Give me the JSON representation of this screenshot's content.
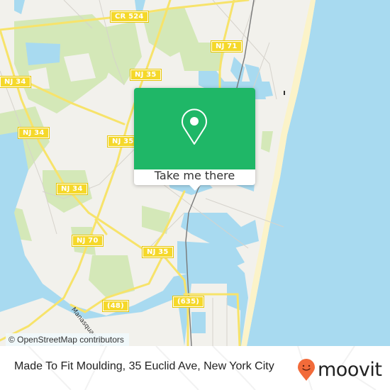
{
  "map": {
    "road_labels": [
      {
        "id": "cr524",
        "text": "CR 524"
      },
      {
        "id": "nj71",
        "text": "NJ 71"
      },
      {
        "id": "nj35-a",
        "text": "NJ 35"
      },
      {
        "id": "nj35-b",
        "text": "NJ 35"
      },
      {
        "id": "nj35-c",
        "text": "NJ 35"
      },
      {
        "id": "nj34-a",
        "text": "NJ 34"
      },
      {
        "id": "nj34-b",
        "text": "NJ 34"
      },
      {
        "id": "nj34-c",
        "text": "NJ 34"
      },
      {
        "id": "nj70",
        "text": "NJ 70"
      },
      {
        "id": "r48",
        "text": "(48)"
      },
      {
        "id": "r635",
        "text": "(635)"
      }
    ],
    "water_labels": [
      {
        "id": "manasquan",
        "text": "Manasquan River"
      }
    ],
    "attribution": "© OpenStreetMap contributors",
    "colors": {
      "land": "#f2f1ec",
      "water": "#a8daf0",
      "park": "#cfe5b0",
      "road": "#f7e36a",
      "beach": "#fbf3c9"
    }
  },
  "popup": {
    "icon": "location-pin-icon",
    "button_label": "Take me there",
    "color": "#1fb767"
  },
  "footer": {
    "title": "Made To Fit Moulding, 35 Euclid Ave, New York City",
    "logo_text": "moovit",
    "logo_icon": "moovit-smiley-pin-icon",
    "logo_color": "#f26b3a"
  }
}
